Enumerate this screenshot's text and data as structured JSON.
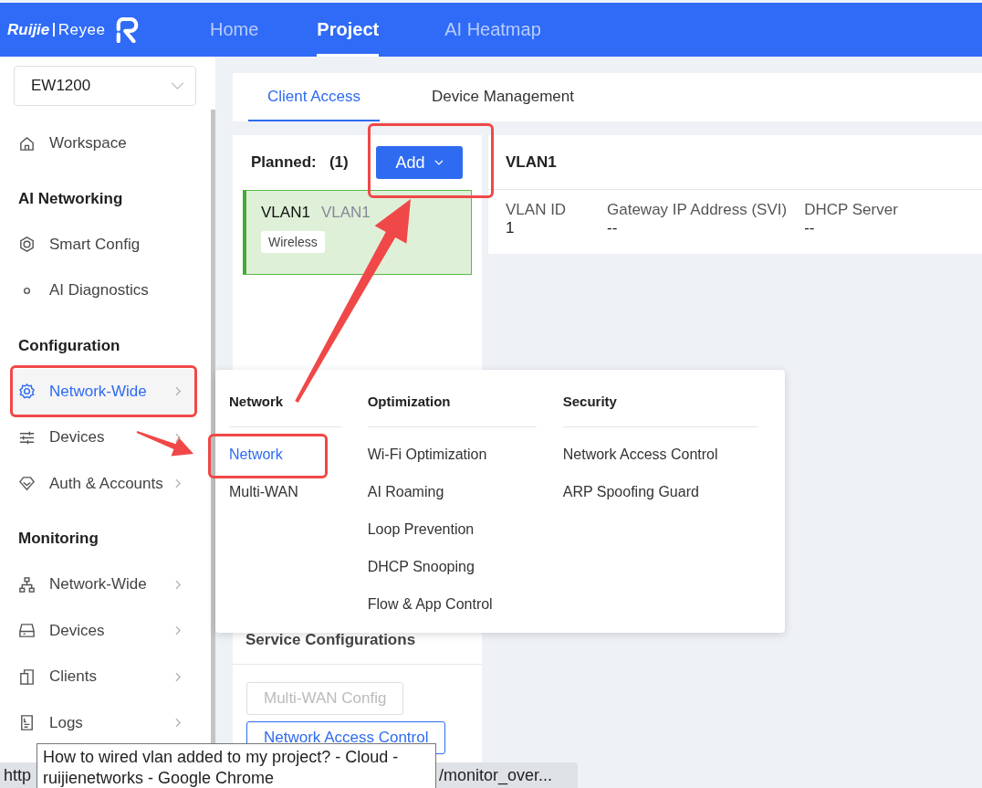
{
  "header": {
    "logo": {
      "brand": "Ruijie",
      "product": "Reyee"
    },
    "nav": [
      {
        "label": "Home",
        "selected": false
      },
      {
        "label": "Project",
        "selected": true
      },
      {
        "label": "AI Heatmap",
        "selected": false
      }
    ]
  },
  "sidebar": {
    "device_select": {
      "value": "EW1200"
    },
    "items": [
      {
        "kind": "link",
        "label": "Workspace",
        "selected": false,
        "has_submenu": false
      },
      {
        "kind": "heading",
        "label": "AI Networking"
      },
      {
        "kind": "link",
        "label": "Smart Config",
        "selected": false,
        "has_submenu": false
      },
      {
        "kind": "link",
        "label": "AI Diagnostics",
        "selected": false,
        "has_submenu": false
      },
      {
        "kind": "heading",
        "label": "Configuration"
      },
      {
        "kind": "link",
        "label": "Network-Wide",
        "selected": true,
        "has_submenu": true
      },
      {
        "kind": "link",
        "label": "Devices",
        "selected": false,
        "has_submenu": true
      },
      {
        "kind": "link",
        "label": "Auth & Accounts",
        "selected": false,
        "has_submenu": true
      },
      {
        "kind": "heading",
        "label": "Monitoring"
      },
      {
        "kind": "link",
        "label": "Network-Wide",
        "selected": false,
        "has_submenu": true
      },
      {
        "kind": "link",
        "label": "Devices",
        "selected": false,
        "has_submenu": true
      },
      {
        "kind": "link",
        "label": "Clients",
        "selected": false,
        "has_submenu": true
      },
      {
        "kind": "link",
        "label": "Logs",
        "selected": false,
        "has_submenu": true
      }
    ]
  },
  "content_tabs": [
    {
      "label": "Client Access",
      "selected": true
    },
    {
      "label": "Device Management",
      "selected": false
    }
  ],
  "planned": {
    "label": "Planned:",
    "count": "(1)",
    "add_button": "Add",
    "networks": [
      {
        "name": "VLAN1",
        "alias": "VLAN1",
        "tag": "Wireless",
        "selected": true
      }
    ]
  },
  "detail": {
    "title": "VLAN1",
    "fields": [
      {
        "label": "VLAN ID",
        "value": "1"
      },
      {
        "label": "Gateway IP Address (SVI)",
        "value": "--"
      },
      {
        "label": "DHCP Server",
        "value": "--"
      }
    ]
  },
  "service_configurations": {
    "title": "Service Configurations",
    "buttons": [
      {
        "label": "Multi-WAN Config",
        "disabled": true
      },
      {
        "label": "Network Access Control",
        "disabled": false
      }
    ]
  },
  "add_menu": {
    "columns": [
      {
        "title": "Network",
        "items": [
          {
            "label": "Network",
            "selected": true
          },
          {
            "label": "Multi-WAN",
            "selected": false
          }
        ]
      },
      {
        "title": "Optimization",
        "items": [
          {
            "label": "Wi-Fi Optimization",
            "selected": false
          },
          {
            "label": "AI Roaming",
            "selected": false
          },
          {
            "label": "Loop Prevention",
            "selected": false
          },
          {
            "label": "DHCP Snooping",
            "selected": false
          },
          {
            "label": "Flow & App Control",
            "selected": false
          }
        ]
      },
      {
        "title": "Security",
        "items": [
          {
            "label": "Network Access Control",
            "selected": false
          },
          {
            "label": "ARP Spoofing Guard",
            "selected": false
          }
        ]
      }
    ]
  },
  "tooltip": {
    "lines": [
      "How to wired vlan added to my project? - Cloud -",
      "ruijienetworks - Google Chrome"
    ]
  },
  "status_bar": {
    "url_start": "http",
    "url_end": "/monitor_over..."
  }
}
